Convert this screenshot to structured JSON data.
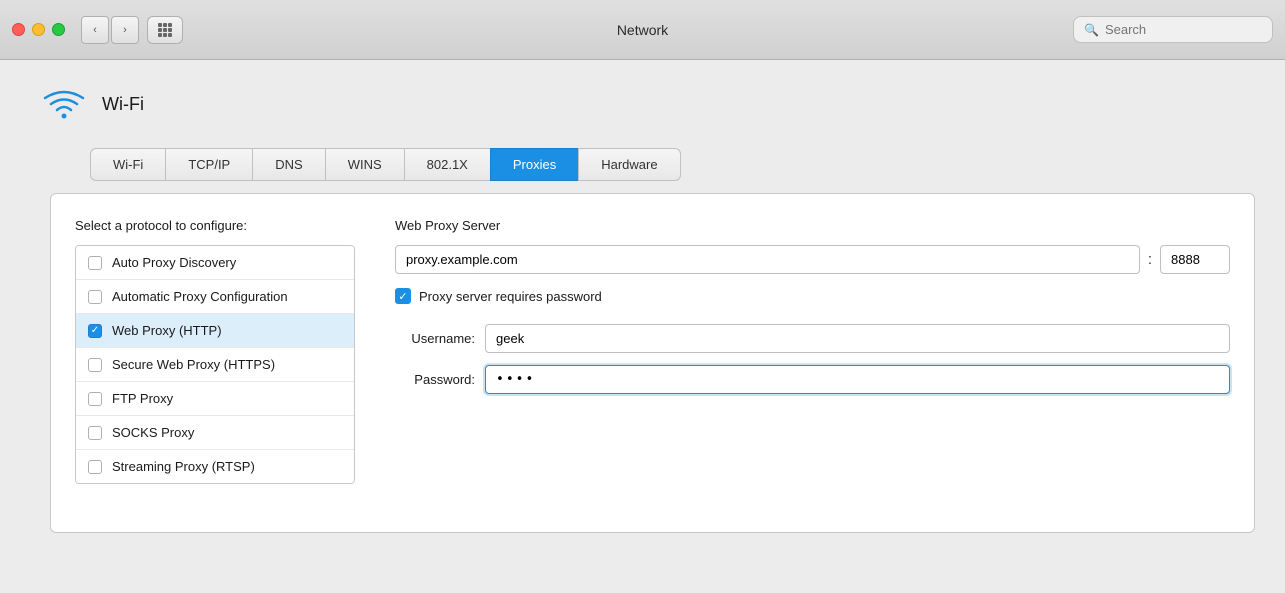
{
  "titlebar": {
    "title": "Network",
    "search_placeholder": "Search"
  },
  "wifi": {
    "label": "Wi-Fi"
  },
  "tabs": [
    {
      "id": "wifi",
      "label": "Wi-Fi",
      "active": false
    },
    {
      "id": "tcpip",
      "label": "TCP/IP",
      "active": false
    },
    {
      "id": "dns",
      "label": "DNS",
      "active": false
    },
    {
      "id": "wins",
      "label": "WINS",
      "active": false
    },
    {
      "id": "8021x",
      "label": "802.1X",
      "active": false
    },
    {
      "id": "proxies",
      "label": "Proxies",
      "active": true
    },
    {
      "id": "hardware",
      "label": "Hardware",
      "active": false
    }
  ],
  "left_panel": {
    "label": "Select a protocol to configure:",
    "protocols": [
      {
        "id": "auto-discovery",
        "label": "Auto Proxy Discovery",
        "checked": false,
        "selected": false
      },
      {
        "id": "auto-config",
        "label": "Automatic Proxy Configuration",
        "checked": false,
        "selected": false
      },
      {
        "id": "web-proxy",
        "label": "Web Proxy (HTTP)",
        "checked": true,
        "selected": true
      },
      {
        "id": "secure-web-proxy",
        "label": "Secure Web Proxy (HTTPS)",
        "checked": false,
        "selected": false
      },
      {
        "id": "ftp-proxy",
        "label": "FTP Proxy",
        "checked": false,
        "selected": false
      },
      {
        "id": "socks-proxy",
        "label": "SOCKS Proxy",
        "checked": false,
        "selected": false
      },
      {
        "id": "streaming-proxy",
        "label": "Streaming Proxy (RTSP)",
        "checked": false,
        "selected": false
      }
    ]
  },
  "right_panel": {
    "section_title": "Web Proxy Server",
    "server_host": "proxy.example.com",
    "server_port": "8888",
    "colon": ":",
    "password_required_label": "Proxy server requires password",
    "username_label": "Username:",
    "username_value": "geek",
    "password_label": "Password:",
    "password_value": "••••"
  },
  "colors": {
    "active_tab": "#1a8fe3",
    "checkbox_checked": "#1a8fe3"
  }
}
